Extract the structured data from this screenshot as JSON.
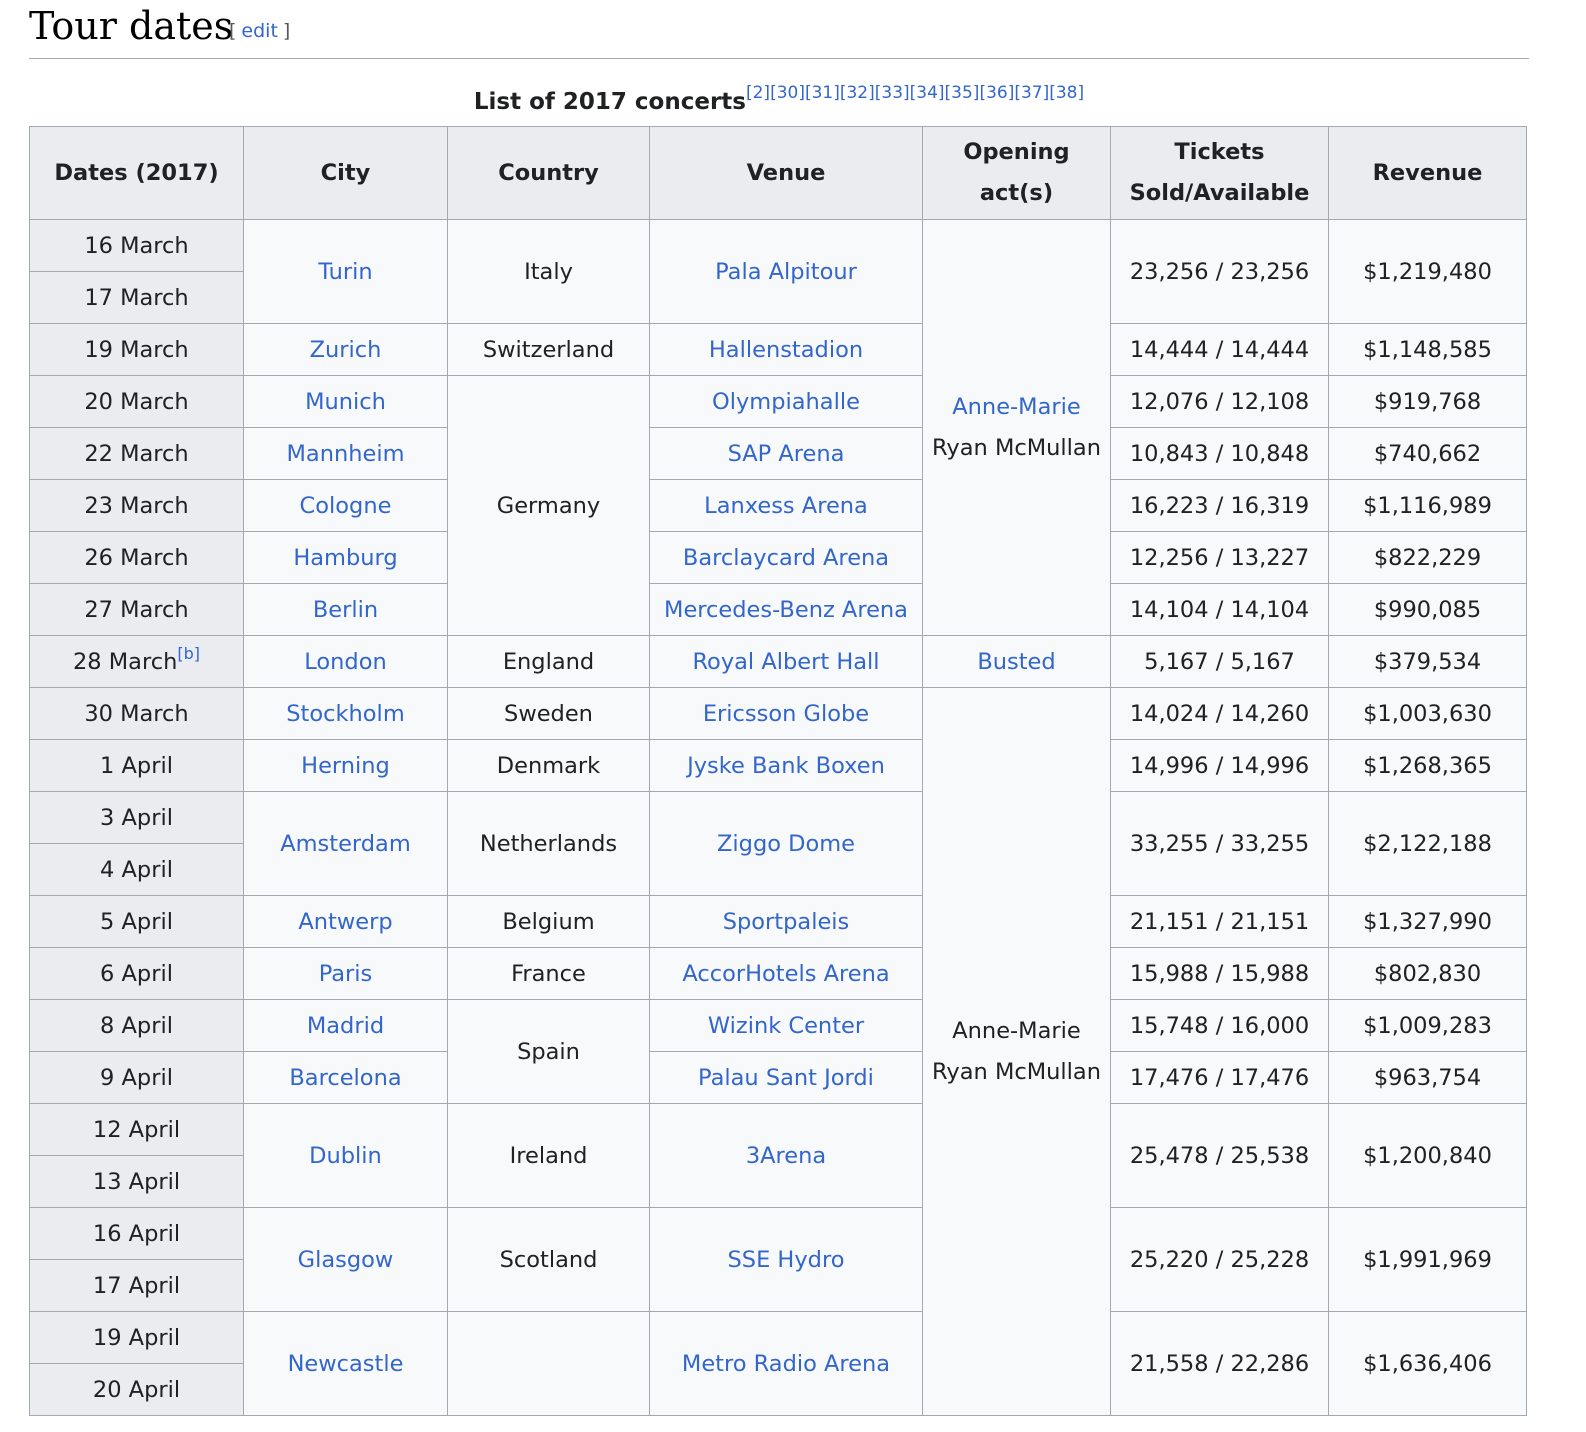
{
  "heading": {
    "title": "Tour dates",
    "edit_open": "[",
    "edit_label": "edit",
    "edit_close": "]"
  },
  "caption": {
    "text": "List of 2017 concerts",
    "refs": "[2][30][31][32][33][34][35][36][37][38]"
  },
  "columns": [
    "Dates (2017)",
    "City",
    "Country",
    "Venue",
    "Opening act(s)",
    "Tickets Sold/Available",
    "Revenue"
  ],
  "rows": [
    {
      "date": "16 March",
      "city": "Turin",
      "country": "Italy",
      "venue": "Pala Alpitour",
      "tickets": "23,256 / 23,256",
      "revenue": "$1,219,480"
    },
    {
      "date": "17 March"
    },
    {
      "date": "19 March",
      "city": "Zurich",
      "country": "Switzerland",
      "venue": "Hallenstadion",
      "tickets": "14,444 / 14,444",
      "revenue": "$1,148,585"
    },
    {
      "date": "20 March",
      "city": "Munich",
      "country": "Germany",
      "venue": "Olympiahalle",
      "tickets": "12,076 / 12,108",
      "revenue": "$919,768"
    },
    {
      "date": "22 March",
      "city": "Mannheim",
      "venue": "SAP Arena",
      "tickets": "10,843 / 10,848",
      "revenue": "$740,662"
    },
    {
      "date": "23 March",
      "city": "Cologne",
      "venue": "Lanxess Arena",
      "tickets": "16,223 / 16,319",
      "revenue": "$1,116,989"
    },
    {
      "date": "26 March",
      "city": "Hamburg",
      "venue": "Barclaycard Arena",
      "tickets": "12,256 / 13,227",
      "revenue": "$822,229"
    },
    {
      "date": "27 March",
      "city": "Berlin",
      "venue": "Mercedes-Benz Arena",
      "tickets": "14,104 / 14,104",
      "revenue": "$990,085"
    },
    {
      "date": "28 March",
      "note": "[b]",
      "city": "London",
      "country": "England",
      "venue": "Royal Albert Hall",
      "tickets": "5,167 / 5,167",
      "revenue": "$379,534"
    },
    {
      "date": "30 March",
      "city": "Stockholm",
      "country": "Sweden",
      "venue": "Ericsson Globe",
      "tickets": "14,024 / 14,260",
      "revenue": "$1,003,630"
    },
    {
      "date": "1 April",
      "city": "Herning",
      "country": "Denmark",
      "venue": "Jyske Bank Boxen",
      "tickets": "14,996 / 14,996",
      "revenue": "$1,268,365"
    },
    {
      "date": "3 April",
      "city": "Amsterdam",
      "country": "Netherlands",
      "venue": "Ziggo Dome",
      "tickets": "33,255 / 33,255",
      "revenue": "$2,122,188"
    },
    {
      "date": "4 April"
    },
    {
      "date": "5 April",
      "city": "Antwerp",
      "country": "Belgium",
      "venue": "Sportpaleis",
      "tickets": "21,151 / 21,151",
      "revenue": "$1,327,990"
    },
    {
      "date": "6 April",
      "city": "Paris",
      "country": "France",
      "venue": "AccorHotels Arena",
      "tickets": "15,988 / 15,988",
      "revenue": "$802,830"
    },
    {
      "date": "8 April",
      "city": "Madrid",
      "country": "Spain",
      "venue": "Wizink Center",
      "tickets": "15,748 / 16,000",
      "revenue": "$1,009,283"
    },
    {
      "date": "9 April",
      "city": "Barcelona",
      "venue": "Palau Sant Jordi",
      "tickets": "17,476 / 17,476",
      "revenue": "$963,754"
    },
    {
      "date": "12 April",
      "city": "Dublin",
      "country": "Ireland",
      "venue": "3Arena",
      "tickets": "25,478 / 25,538",
      "revenue": "$1,200,840"
    },
    {
      "date": "13 April"
    },
    {
      "date": "16 April",
      "city": "Glasgow",
      "country": "Scotland",
      "venue": "SSE Hydro",
      "tickets": "25,220 / 25,228",
      "revenue": "$1,991,969"
    },
    {
      "date": "17 April"
    },
    {
      "date": "19 April",
      "city": "Newcastle",
      "venue": "Metro Radio Arena",
      "tickets": "21,558 / 22,286",
      "revenue": "$1,636,406"
    },
    {
      "date": "20 April"
    }
  ],
  "opening_acts": {
    "group1": {
      "first": "Anne-Marie",
      "second": "Ryan McMullan"
    },
    "group2": {
      "first": "Busted"
    },
    "group3": {
      "first": "Anne-Marie",
      "second": "Ryan McMullan"
    }
  },
  "colors": {
    "link": "#3366cc",
    "header_bg": "#eaecf0",
    "cell_bg": "#f8f9fa",
    "border": "#a2a9b1"
  }
}
